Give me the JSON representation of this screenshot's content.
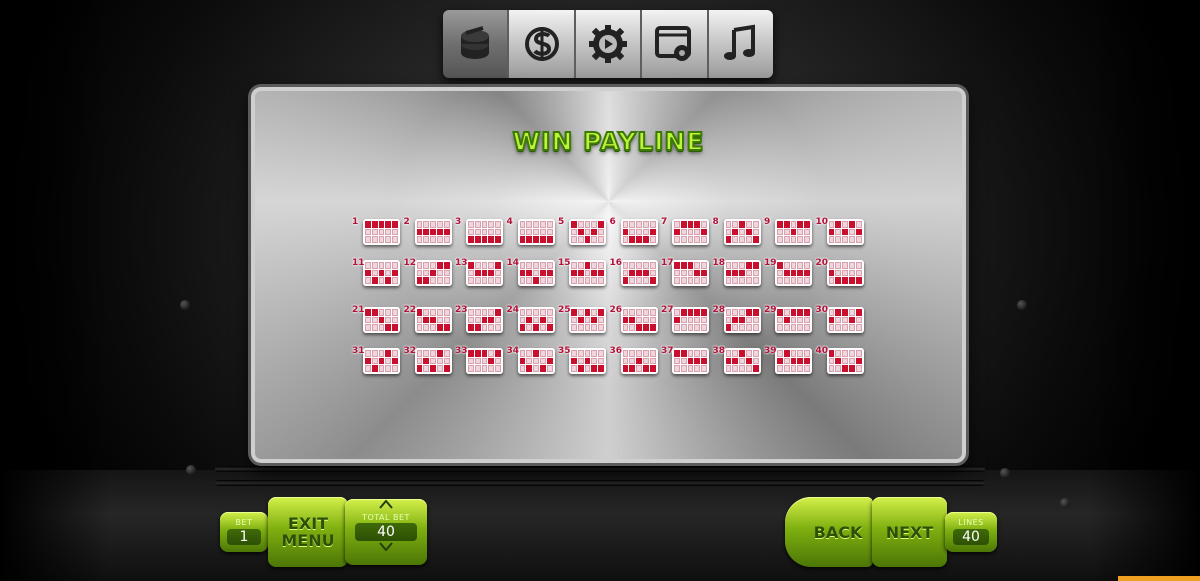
{
  "topbar": {
    "tabs": [
      {
        "icon": "coins-stack-icon",
        "active": true
      },
      {
        "icon": "dollar-globe-icon",
        "active": false
      },
      {
        "icon": "play-gear-icon",
        "active": false
      },
      {
        "icon": "window-settings-icon",
        "active": false
      },
      {
        "icon": "music-note-icon",
        "active": false
      }
    ]
  },
  "panel": {
    "title": "WIN PAYLINE",
    "paylines": [
      {
        "n": "1",
        "rows": [
          0,
          0,
          0,
          0,
          0
        ]
      },
      {
        "n": "2",
        "rows": [
          1,
          1,
          1,
          1,
          1
        ]
      },
      {
        "n": "3",
        "rows": [
          2,
          2,
          2,
          2,
          2
        ]
      },
      {
        "n": "4",
        "rows": [
          2,
          2,
          2,
          2,
          2
        ]
      },
      {
        "n": "5",
        "rows": [
          0,
          1,
          2,
          1,
          0
        ]
      },
      {
        "n": "6",
        "rows": [
          1,
          2,
          2,
          2,
          1
        ]
      },
      {
        "n": "7",
        "rows": [
          1,
          0,
          0,
          0,
          1
        ]
      },
      {
        "n": "8",
        "rows": [
          2,
          1,
          0,
          1,
          2
        ]
      },
      {
        "n": "9",
        "rows": [
          0,
          0,
          1,
          0,
          0
        ]
      },
      {
        "n": "10",
        "rows": [
          1,
          0,
          1,
          0,
          1
        ]
      },
      {
        "n": "11",
        "rows": [
          1,
          2,
          1,
          2,
          1
        ]
      },
      {
        "n": "12",
        "rows": [
          2,
          2,
          1,
          0,
          0
        ]
      },
      {
        "n": "13",
        "rows": [
          0,
          1,
          1,
          1,
          0
        ]
      },
      {
        "n": "14",
        "rows": [
          1,
          1,
          2,
          1,
          1
        ]
      },
      {
        "n": "15",
        "rows": [
          1,
          1,
          0,
          1,
          1
        ]
      },
      {
        "n": "16",
        "rows": [
          2,
          1,
          1,
          1,
          2
        ]
      },
      {
        "n": "17",
        "rows": [
          0,
          0,
          0,
          1,
          1
        ]
      },
      {
        "n": "18",
        "rows": [
          1,
          1,
          1,
          0,
          0
        ]
      },
      {
        "n": "19",
        "rows": [
          0,
          1,
          1,
          1,
          1
        ]
      },
      {
        "n": "20",
        "rows": [
          1,
          2,
          2,
          2,
          2
        ]
      },
      {
        "n": "21",
        "rows": [
          0,
          0,
          1,
          2,
          2
        ]
      },
      {
        "n": "22",
        "rows": [
          0,
          1,
          1,
          2,
          2
        ]
      },
      {
        "n": "23",
        "rows": [
          2,
          2,
          1,
          1,
          0
        ]
      },
      {
        "n": "24",
        "rows": [
          2,
          1,
          2,
          1,
          2
        ]
      },
      {
        "n": "25",
        "rows": [
          0,
          1,
          0,
          1,
          0
        ]
      },
      {
        "n": "26",
        "rows": [
          1,
          1,
          2,
          2,
          2
        ]
      },
      {
        "n": "27",
        "rows": [
          1,
          0,
          0,
          0,
          0
        ]
      },
      {
        "n": "28",
        "rows": [
          2,
          1,
          1,
          0,
          0
        ]
      },
      {
        "n": "29",
        "rows": [
          0,
          1,
          0,
          0,
          0
        ]
      },
      {
        "n": "30",
        "rows": [
          1,
          0,
          0,
          1,
          0
        ]
      },
      {
        "n": "31",
        "rows": [
          1,
          2,
          1,
          0,
          1
        ]
      },
      {
        "n": "32",
        "rows": [
          2,
          1,
          2,
          0,
          2
        ]
      },
      {
        "n": "33",
        "rows": [
          0,
          0,
          0,
          1,
          0
        ]
      },
      {
        "n": "34",
        "rows": [
          1,
          2,
          0,
          2,
          1
        ]
      },
      {
        "n": "35",
        "rows": [
          1,
          2,
          1,
          2,
          2
        ]
      },
      {
        "n": "36",
        "rows": [
          2,
          2,
          1,
          2,
          2
        ]
      },
      {
        "n": "37",
        "rows": [
          0,
          0,
          1,
          1,
          1
        ]
      },
      {
        "n": "38",
        "rows": [
          1,
          1,
          0,
          1,
          2
        ]
      },
      {
        "n": "39",
        "rows": [
          1,
          0,
          1,
          1,
          1
        ]
      },
      {
        "n": "40",
        "rows": [
          0,
          1,
          2,
          2,
          1
        ]
      }
    ]
  },
  "controls": {
    "bet_label": "BET",
    "bet_value": "1",
    "exit_line1": "EXIT",
    "exit_line2": "MENU",
    "total_bet_label": "TOTAL BET",
    "total_bet_value": "40",
    "back_label": "BACK",
    "next_label": "NEXT",
    "lines_label": "LINES",
    "lines_value": "40"
  },
  "colors": {
    "accent_green": "#9ccd1e",
    "payline_red": "#c8102e",
    "title_green": "#bff33a"
  }
}
